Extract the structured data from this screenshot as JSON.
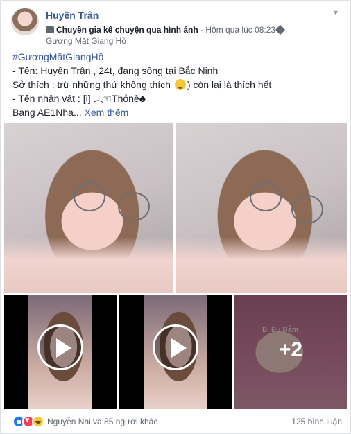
{
  "post": {
    "author": "Huyền Trân",
    "badge": "Chuyên gia kể chuyện qua hình ảnh",
    "separator": " · ",
    "time": "Hôm qua lúc 08:23",
    "group": "Gương Mặt Giang Hồ",
    "hashtag": "#GươngMặtGiangHồ",
    "line1": "- Tên: Huyền Trân , 24t, đang sống tại Bắc Ninh",
    "line2_before": "Sở thích : trừ những thứ không thích ",
    "line2_after": ") còn lại là thích hết",
    "line3": "- Tên nhân vật : [i] ︵☜Thỏnè♣",
    "line4": "Bang AE1Nha...",
    "see_more": "Xem thêm"
  },
  "media": {
    "more_count": "+2",
    "more_caption": "Bị Bụ Bẫm"
  },
  "reactions": {
    "icons": [
      "like-icon",
      "love-icon",
      "haha-icon"
    ],
    "summary": "Nguyễn Nhi và 85 người khác",
    "comments": "125 bình luận"
  },
  "colors": {
    "link": "#385898",
    "text": "#1d2129",
    "meta": "#606770",
    "like": "#2078f4",
    "love": "#f33e58",
    "haha": "#f7c73b"
  }
}
